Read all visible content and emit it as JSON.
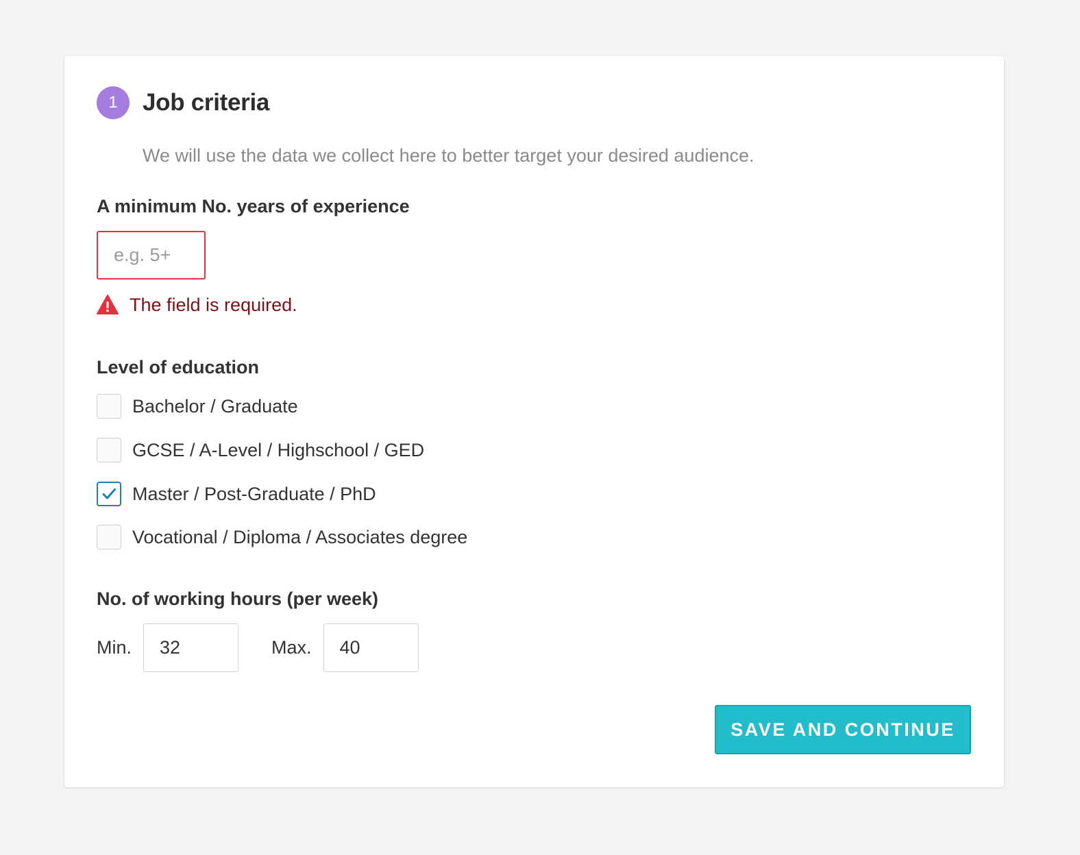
{
  "form": {
    "step_number": "1",
    "title": "Job criteria",
    "subtitle": "We will use the data we collect here to better target your desired audience."
  },
  "experience": {
    "label": "A minimum No. years of experience",
    "placeholder": "e.g. 5+",
    "value": "",
    "error": "The field is required."
  },
  "education": {
    "label": "Level of education",
    "options": [
      {
        "label": "Bachelor / Graduate",
        "checked": false
      },
      {
        "label": "GCSE / A-Level / Highschool / GED",
        "checked": false
      },
      {
        "label": "Master / Post-Graduate / PhD",
        "checked": true
      },
      {
        "label": "Vocational / Diploma / Associates degree",
        "checked": false
      }
    ]
  },
  "hours": {
    "label": "No. of working hours (per week)",
    "min_label": "Min.",
    "min_value": "32",
    "max_label": "Max.",
    "max_value": "40"
  },
  "actions": {
    "save_label": "SAVE AND CONTINUE"
  },
  "colors": {
    "accent": "#23bccb",
    "step_badge": "#a47ddf",
    "error": "#e2323f",
    "error_text": "#7a1318",
    "checkbox_checked": "#1f7fb8"
  },
  "icons": {
    "error": "warning-triangle-icon",
    "checked": "checkmark-icon"
  }
}
